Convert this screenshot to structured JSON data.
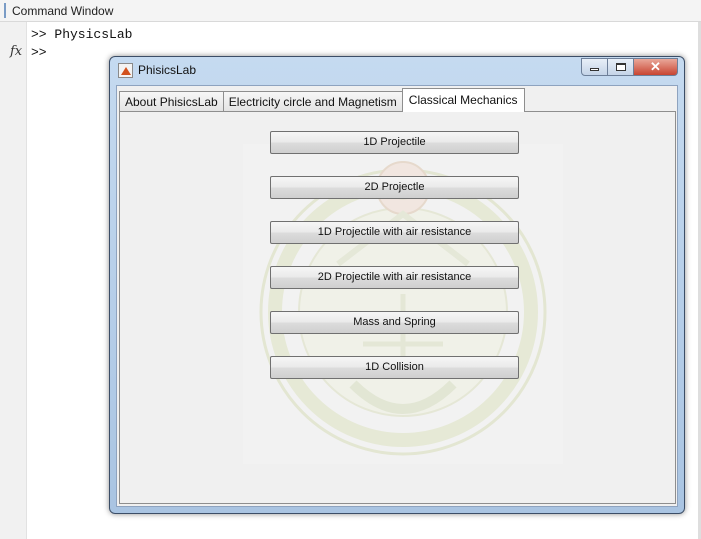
{
  "command_window": {
    "title": "Command Window",
    "lines": [
      ">> PhysicsLab",
      ">>"
    ],
    "fx_label": "fx"
  },
  "figure": {
    "title": "PhisicsLab",
    "controls": {
      "minimize_icon": "minimize-icon",
      "maximize_icon": "maximize-icon",
      "close_glyph": "✕"
    },
    "tabs": [
      {
        "label": "About PhisicsLab",
        "active": false
      },
      {
        "label": "Electricity circle and Magnetism",
        "active": false
      },
      {
        "label": "Classical Mechanics",
        "active": true
      }
    ],
    "buttons": [
      "1D Projectile",
      "2D Projectle",
      "1D Projectile with air resistance",
      "2D Projectile with air resistance",
      "Mass and Spring",
      "1D Collision"
    ]
  },
  "colors": {
    "title_bar": "#b8cfea",
    "close_button": "#c84431",
    "panel_bg": "#f0f0f0",
    "emblem": "#d6dcc4"
  }
}
